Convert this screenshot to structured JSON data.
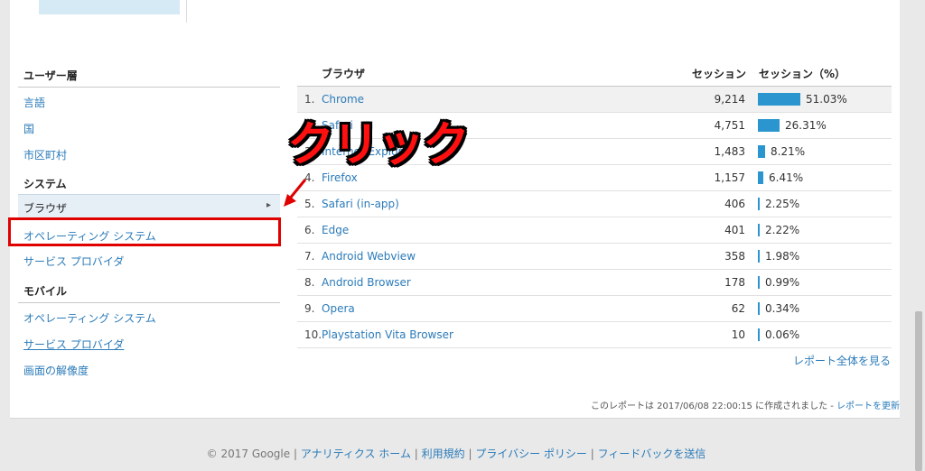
{
  "left_nav": {
    "sections": [
      {
        "title": "ユーザー層",
        "items": [
          "言語",
          "国",
          "市区町村"
        ]
      },
      {
        "title": "システム",
        "selected": "ブラウザ",
        "items": [
          "オペレーティング システム",
          "サービス プロバイダ"
        ]
      },
      {
        "title": "モバイル",
        "items": [
          "オペレーティング システム",
          "サービス プロバイダ",
          "画面の解像度"
        ]
      }
    ]
  },
  "annotation": {
    "text": "クリック",
    "color": "#ff1010"
  },
  "table": {
    "headers": {
      "dimension": "ブラウザ",
      "sessions": "セッション",
      "sessions_pct": "セッション（%）"
    },
    "rows": [
      {
        "rank": "1.",
        "name": "Chrome",
        "sessions": "9,214",
        "pct": "51.03%",
        "share": 51.03
      },
      {
        "rank": "2.",
        "name": "Safari",
        "sessions": "4,751",
        "pct": "26.31%",
        "share": 26.31
      },
      {
        "rank": "3.",
        "name": "Internet Explorer",
        "sessions": "1,483",
        "pct": "8.21%",
        "share": 8.21
      },
      {
        "rank": "4.",
        "name": "Firefox",
        "sessions": "1,157",
        "pct": "6.41%",
        "share": 6.41
      },
      {
        "rank": "5.",
        "name": "Safari (in-app)",
        "sessions": "406",
        "pct": "2.25%",
        "share": 2.25
      },
      {
        "rank": "6.",
        "name": "Edge",
        "sessions": "401",
        "pct": "2.22%",
        "share": 2.22
      },
      {
        "rank": "7.",
        "name": "Android Webview",
        "sessions": "358",
        "pct": "1.98%",
        "share": 1.98
      },
      {
        "rank": "8.",
        "name": "Android Browser",
        "sessions": "178",
        "pct": "0.99%",
        "share": 0.99
      },
      {
        "rank": "9.",
        "name": "Opera",
        "sessions": "62",
        "pct": "0.34%",
        "share": 0.34
      },
      {
        "rank": "10.",
        "name": "Playstation Vita Browser",
        "sessions": "10",
        "pct": "0.06%",
        "share": 0.06
      }
    ],
    "full_report": "レポート全体を見る"
  },
  "report_note": {
    "text": "このレポートは 2017/06/08 22:00:15 に作成されました - ",
    "refresh": "レポートを更新"
  },
  "footer": {
    "copyright": "© 2017 Google",
    "links": [
      "アナリティクス ホーム",
      "利用規約",
      "プライバシー ポリシー",
      "フィードバックを送信"
    ],
    "separator": " | "
  },
  "colors": {
    "accent": "#2b95d0",
    "link": "#2b7bb9",
    "highlight": "#e00000"
  }
}
